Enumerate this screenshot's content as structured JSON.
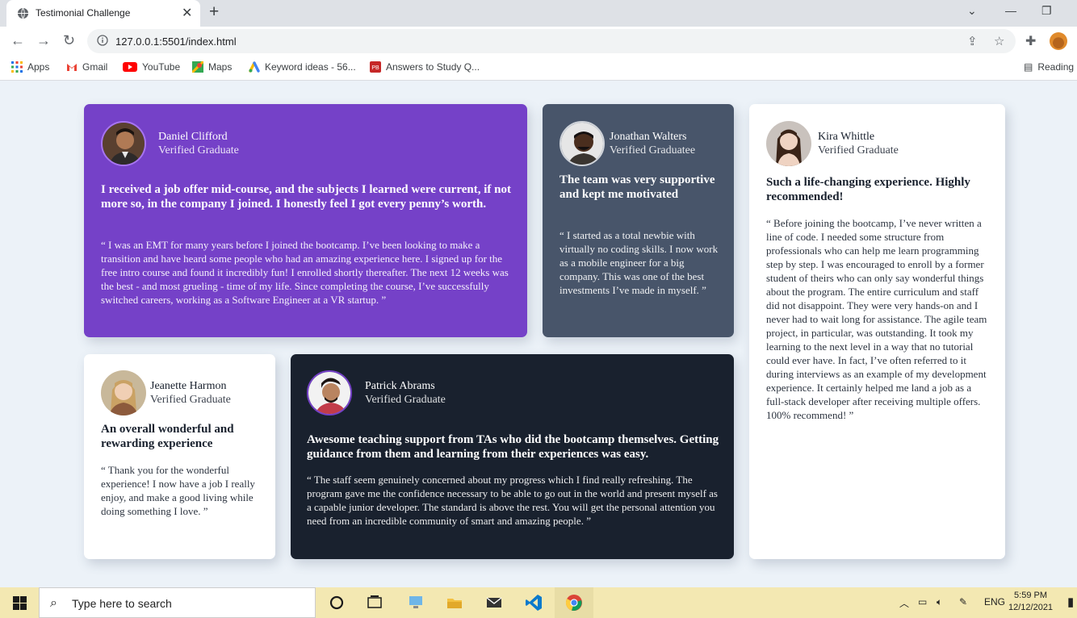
{
  "browser": {
    "tab_title": "Testimonial Challenge",
    "tab_close": "✕",
    "new_tab": "+",
    "url": "127.0.0.1:5501/index.html",
    "bookmarks": [
      {
        "label": "Apps",
        "icon": "apps-grid-icon"
      },
      {
        "label": "Gmail",
        "icon": "gmail-icon"
      },
      {
        "label": "YouTube",
        "icon": "youtube-icon"
      },
      {
        "label": "Maps",
        "icon": "maps-icon"
      },
      {
        "label": "Keyword ideas - 56...",
        "icon": "google-ads-icon"
      },
      {
        "label": "Answers to Study Q...",
        "icon": "pb-icon"
      }
    ],
    "reading_list": "Reading"
  },
  "testimonials": [
    {
      "name": "Daniel Clifford",
      "status": "Verified Graduate",
      "headline": "I received a job offer mid-course, and the subjects I learned were current, if not more so, in the company I joined. I honestly feel I got every penny’s worth.",
      "quote": "“ I was an EMT for many years before I joined the bootcamp. I’ve been looking to make a transition and have heard some people who had an amazing experience here. I signed up for the free intro course and found it incredibly fun! I enrolled shortly thereafter. The next 12 weeks was the best - and most grueling - time of my life. Since completing the course, I’ve successfully switched careers, working as a Software Engineer at a VR startup. ”"
    },
    {
      "name": "Jonathan Walters",
      "status": "Verified Graduatee",
      "headline": "The team was very supportive and kept me motivated",
      "quote": "“ I started as a total newbie with virtually no coding skills. I now work as a mobile engineer for a big company. This was one of the best investments I’ve made in myself. ”"
    },
    {
      "name": "Kira Whittle",
      "status": "Verified Graduate",
      "headline": "Such a life-changing experience. Highly recommended!",
      "quote": "“ Before joining the bootcamp, I’ve never written a line of code. I needed some structure from professionals who can help me learn programming step by step. I was encouraged to enroll by a former student of theirs who can only say wonderful things about the program. The entire curriculum and staff did not disappoint. They were very hands-on and I never had to wait long for assistance. The agile team project, in particular, was outstanding. It took my learning to the next level in a way that no tutorial could ever have. In fact, I’ve often referred to it during interviews as an example of my development experience. It certainly helped me land a job as a full-stack developer after receiving multiple offers. 100% recommend! ”"
    },
    {
      "name": "Jeanette Harmon",
      "status": "Verified Graduate",
      "headline": "An overall wonderful and rewarding experience",
      "quote": "“ Thank you for the wonderful experience! I now have a job I really enjoy, and make a good living while doing something I love. ”"
    },
    {
      "name": "Patrick Abrams",
      "status": "Verified Graduate",
      "headline": "Awesome teaching support from TAs who did the bootcamp themselves. Getting guidance from them and learning from their experiences was easy.",
      "quote": "“ The staff seem genuinely concerned about my progress which I find really refreshing. The program gave me the confidence necessary to be able to go out in the world and present myself as a capable junior developer. The standard is above the rest. You will get the personal attention you need from an incredible community of smart and amazing people. ”"
    }
  ],
  "colors": {
    "page_bg": "#ecf2f8",
    "moderate_violet": "#7541c8",
    "grayish_blue": "#48556a",
    "white": "#ffffff",
    "very_dark_blue": "#19212e"
  },
  "taskbar": {
    "search_placeholder": "Type here to search",
    "lang": "ENG",
    "time": "5:59 PM",
    "date": "12/12/2021"
  }
}
